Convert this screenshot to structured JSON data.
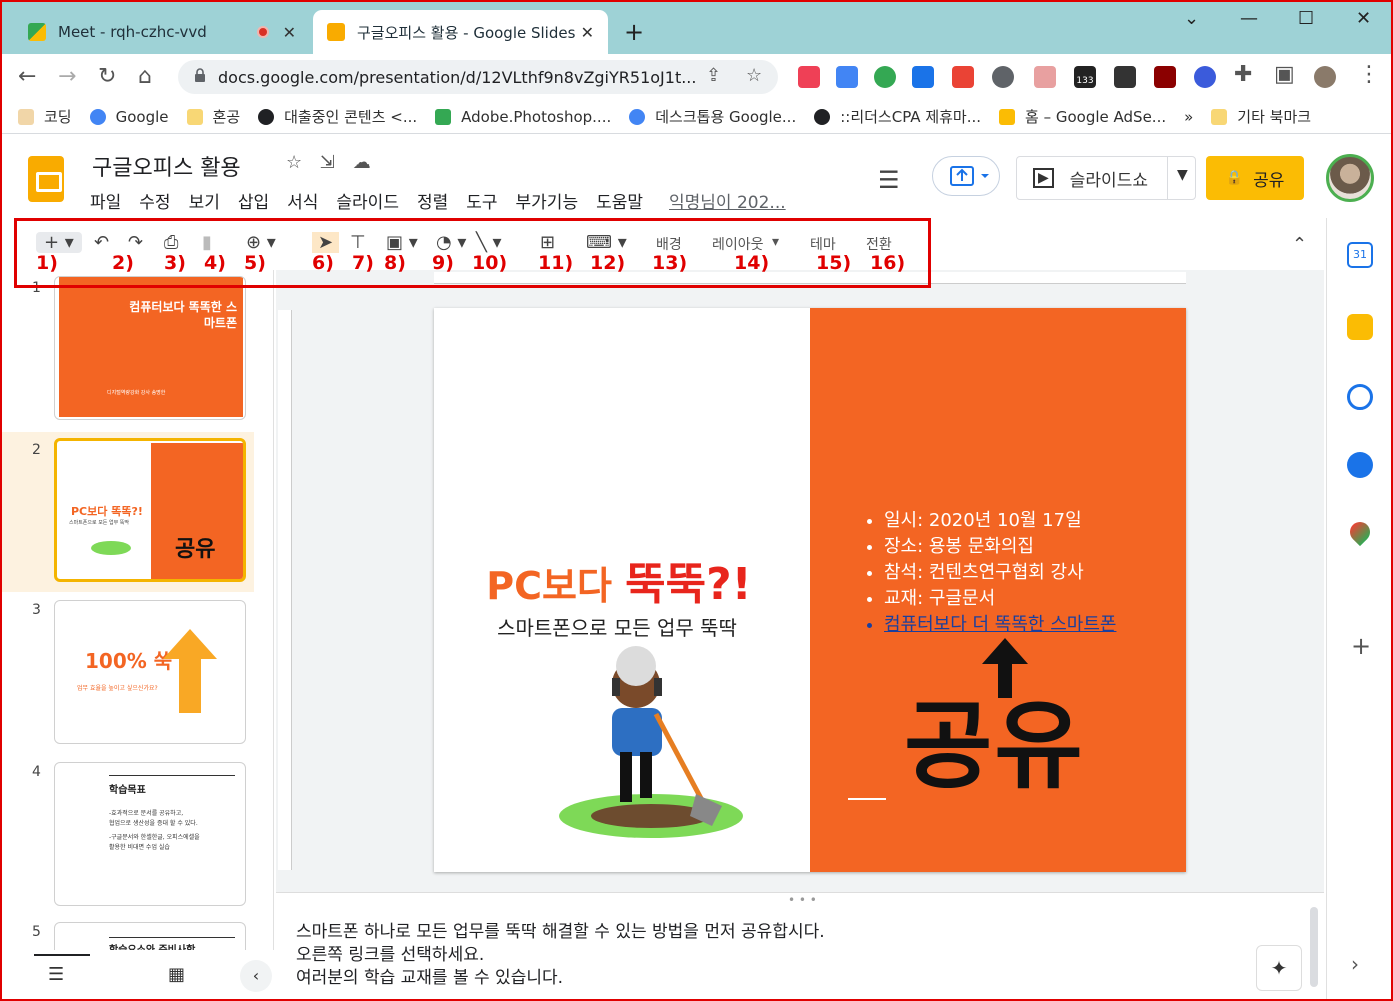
{
  "browser": {
    "tabs": [
      {
        "title": "Meet - rqh-czhc-vvd"
      },
      {
        "title": "구글오피스 활용 - Google Slides"
      }
    ],
    "url": "docs.google.com/presentation/d/12VLthf9n8vZgiYR51oJ1t...",
    "extension_badge": "133",
    "bookmarks": [
      {
        "label": "코딩",
        "icon_color": "#f1d6a8"
      },
      {
        "label": "Google",
        "icon_color": "#4285f4"
      },
      {
        "label": "혼공",
        "icon_color": "#f8d775"
      },
      {
        "label": "대출중인 콘텐츠 <...",
        "icon_color": "#202124"
      },
      {
        "label": "Adobe.Photoshop....",
        "icon_color": "#34a853"
      },
      {
        "label": "데스크톱용 Google...",
        "icon_color": "#4285f4"
      },
      {
        "label": "::리더스CPA 제휴마...",
        "icon_color": "#202124"
      },
      {
        "label": "홈 – Google AdSe...",
        "icon_color": "#fbbc04"
      }
    ],
    "bookmarks_more": "»",
    "other_bookmarks": "기타 북마크"
  },
  "app": {
    "doc_title": "구글오피스 활용",
    "menu": [
      "파일",
      "수정",
      "보기",
      "삽입",
      "서식",
      "슬라이드",
      "정렬",
      "도구",
      "부가기능",
      "도움말"
    ],
    "last_edit": "익명님이 202...",
    "slideshow_label": "슬라이드쇼",
    "share_label": "공유",
    "accent": "#fbbc04"
  },
  "toolbar": {
    "background_label": "배경",
    "layout_label": "레이아웃",
    "theme_label": "테마",
    "transition_label": "전환",
    "annotations": [
      "1)",
      "2)",
      "3)",
      "4)",
      "5)",
      "6)",
      "7)",
      "8)",
      "9)",
      "10)",
      "11)",
      "12)",
      "13)",
      "14)",
      "15)",
      "16)"
    ]
  },
  "filmstrip": {
    "slides": [
      {
        "number": "1",
        "title": "컴퓨터보다 똑똑한 스마트폰",
        "footer": "디지털역량강화 강사 송명한"
      },
      {
        "number": "2",
        "title": "PC보다 똑똑?!",
        "subtitle": "스마트폰으로 모든 업무 뚝딱",
        "big": "공유"
      },
      {
        "number": "3",
        "title": "100% 쑥",
        "subtitle": "업무 효율을 높이고 싶으신가요?"
      },
      {
        "number": "4",
        "title": "학습목표",
        "lines": [
          "-효과적으로 문서를 공유하고,",
          "협업으로 생산성을 증대 할 수 있다.",
          "-구글문서와 한셀한글, 오피스에셀을",
          "활용한 비대면 수업 실습"
        ]
      },
      {
        "number": "5",
        "title": "학습요소와 준비사항"
      }
    ]
  },
  "slide": {
    "heading_a": "PC보다",
    "heading_b": "뚝뚝?!",
    "subtitle": "스마트폰으로 모든 업무 뚝딱",
    "bullets": [
      "일시: 2020년 10월 17일",
      "장소: 용봉 문화의집",
      "참석: 컨텐츠연구협회 강사",
      "교재: 구글문서",
      "컴퓨터보다 더 똑똑한 스마트폰"
    ],
    "big_text": "공유",
    "colors": {
      "orange": "#f36523",
      "red": "#e8251c",
      "link": "#1a3f9e"
    }
  },
  "notes": {
    "lines": [
      "스마트폰 하나로 모든 업무를 뚝딱 해결할 수 있는 방법을 먼저 공유합시다.",
      "오른쪽 링크를 선택하세요.",
      "여러분의 학습 교재를 볼 수 있습니다."
    ]
  },
  "sidepanel": {
    "calendar_day": "31"
  }
}
